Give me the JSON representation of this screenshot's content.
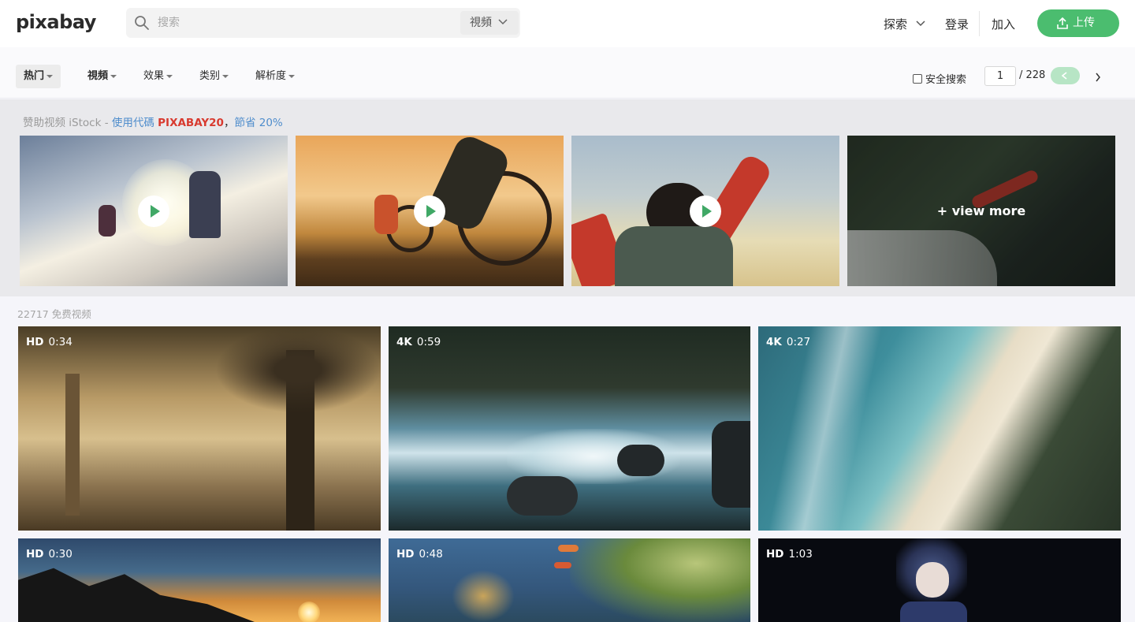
{
  "header": {
    "logo": "pixabay",
    "search_placeholder": "搜索",
    "search_type": "視頻",
    "explore": "探索",
    "login": "登录",
    "join": "加入",
    "upload": "上传"
  },
  "filters": {
    "popular": "热门",
    "video": "視頻",
    "effects": "效果",
    "category": "类别",
    "resolution": "解析度",
    "safe_search": "安全搜索",
    "page": "1",
    "total_pages": "/ 228"
  },
  "sponsor": {
    "prefix": "赞助视频 iStock - ",
    "code_label": "使用代碼 ",
    "code": "PIXABAY20",
    "suffix": "，",
    "save": "節省 20%",
    "view_more": "+ view more"
  },
  "results": {
    "count": "22717 免费视频",
    "videos": [
      {
        "quality": "HD",
        "duration": "0:34"
      },
      {
        "quality": "4K",
        "duration": "0:59"
      },
      {
        "quality": "4K",
        "duration": "0:27"
      },
      {
        "quality": "HD",
        "duration": "0:30"
      },
      {
        "quality": "HD",
        "duration": "0:48"
      },
      {
        "quality": "HD",
        "duration": "1:03"
      }
    ]
  },
  "colors": {
    "brand_green": "#4bbd6f",
    "code_red": "#d83a2f",
    "link_blue": "#4f8dcc"
  }
}
